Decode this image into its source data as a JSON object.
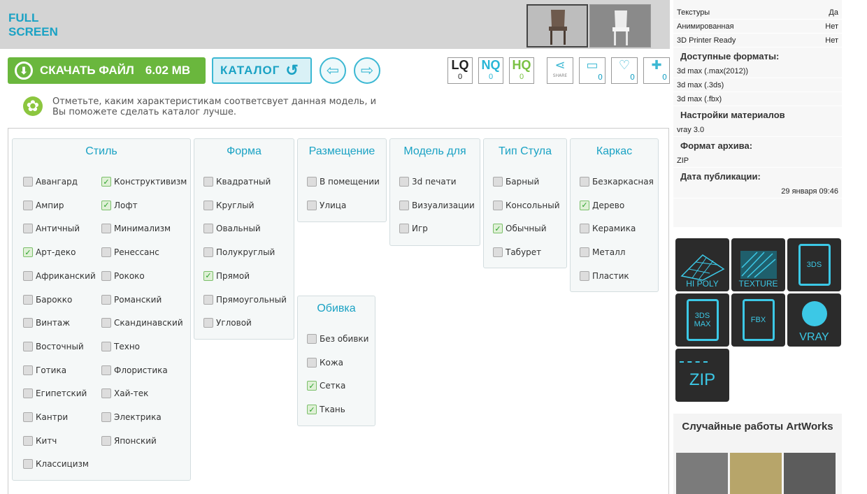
{
  "fullscreen": {
    "line1": "FULL",
    "line2": "SCREEN"
  },
  "download": {
    "label": "СКАЧАТЬ ФАЙЛ",
    "size": "6.02 MB"
  },
  "catalog": {
    "label": "КАТАЛОГ"
  },
  "quality": [
    {
      "label": "LQ",
      "count": "0",
      "color": "#222222"
    },
    {
      "label": "NQ",
      "count": "0",
      "color": "#29b6d6"
    },
    {
      "label": "HQ",
      "count": "0",
      "color": "#7ac143"
    }
  ],
  "social": {
    "share": "SHARE",
    "comments": "0",
    "likes": "0",
    "add": "0"
  },
  "hint": "Отметьте, каким характеристикам соответсвует данная модель, и Вы поможете сделать каталог лучше.",
  "groups": {
    "style": {
      "title": "Стиль",
      "col1": [
        {
          "label": "Авангард",
          "checked": false
        },
        {
          "label": "Ампир",
          "checked": false
        },
        {
          "label": "Античный",
          "checked": false
        },
        {
          "label": "Арт-деко",
          "checked": true
        },
        {
          "label": "Африканский",
          "checked": false
        },
        {
          "label": "Барокко",
          "checked": false
        },
        {
          "label": "Винтаж",
          "checked": false
        },
        {
          "label": "Восточный",
          "checked": false
        },
        {
          "label": "Готика",
          "checked": false
        },
        {
          "label": "Египетский",
          "checked": false
        },
        {
          "label": "Кантри",
          "checked": false
        },
        {
          "label": "Китч",
          "checked": false
        },
        {
          "label": "Классицизм",
          "checked": false
        }
      ],
      "col2": [
        {
          "label": "Конструктивизм",
          "checked": true
        },
        {
          "label": "Лофт",
          "checked": true
        },
        {
          "label": "Минимализм",
          "checked": false
        },
        {
          "label": "Ренессанс",
          "checked": false
        },
        {
          "label": "Рококо",
          "checked": false
        },
        {
          "label": "Романский",
          "checked": false
        },
        {
          "label": "Скандинавский",
          "checked": false
        },
        {
          "label": "Техно",
          "checked": false
        },
        {
          "label": "Флористика",
          "checked": false
        },
        {
          "label": "Хай-тек",
          "checked": false
        },
        {
          "label": "Электрика",
          "checked": false
        },
        {
          "label": "Японский",
          "checked": false
        }
      ]
    },
    "shape": {
      "title": "Форма",
      "items": [
        {
          "label": "Квадратный",
          "checked": false
        },
        {
          "label": "Круглый",
          "checked": false
        },
        {
          "label": "Овальный",
          "checked": false
        },
        {
          "label": "Полукруглый",
          "checked": false
        },
        {
          "label": "Прямой",
          "checked": true
        },
        {
          "label": "Прямоугольный",
          "checked": false
        },
        {
          "label": "Угловой",
          "checked": false
        }
      ]
    },
    "placement": {
      "title": "Размещение",
      "items": [
        {
          "label": "В помещении",
          "checked": false
        },
        {
          "label": "Улица",
          "checked": false
        }
      ]
    },
    "model_for": {
      "title": "Модель для",
      "items": [
        {
          "label": "3d печати",
          "checked": false
        },
        {
          "label": "Визуализации",
          "checked": false
        },
        {
          "label": "Игр",
          "checked": false
        }
      ]
    },
    "chair_type": {
      "title": "Тип Стула",
      "items": [
        {
          "label": "Барный",
          "checked": false
        },
        {
          "label": "Консольный",
          "checked": false
        },
        {
          "label": "Обычный",
          "checked": true
        },
        {
          "label": "Табурет",
          "checked": false
        }
      ]
    },
    "frame": {
      "title": "Каркас",
      "items": [
        {
          "label": "Безкаркасная",
          "checked": false
        },
        {
          "label": "Дерево",
          "checked": true
        },
        {
          "label": "Керамика",
          "checked": false
        },
        {
          "label": "Металл",
          "checked": false
        },
        {
          "label": "Пластик",
          "checked": false
        }
      ]
    },
    "upholstery": {
      "title": "Обивка",
      "items": [
        {
          "label": "Без обивки",
          "checked": false
        },
        {
          "label": "Кожа",
          "checked": false
        },
        {
          "label": "Сетка",
          "checked": true
        },
        {
          "label": "Ткань",
          "checked": true
        }
      ]
    }
  },
  "sidebar": {
    "props": [
      {
        "k": "Текстуры",
        "v": "Да"
      },
      {
        "k": "Анимированная",
        "v": "Нет"
      },
      {
        "k": "3D Printer Ready",
        "v": "Нет"
      }
    ],
    "formats_title": "Доступные форматы:",
    "formats": [
      "3d max (.max(2012))",
      "3d max (.3ds)",
      "3d max (.fbx)"
    ],
    "materials_title": "Настройки материалов",
    "materials": "vray 3.0",
    "archive_title": "Формат архива:",
    "archive": "ZIP",
    "date_title": "Дата публикации:",
    "date": "29 января 09:46"
  },
  "tiles": [
    {
      "label": "HI POLY"
    },
    {
      "label": "TEXTURE"
    },
    {
      "label": "3DS"
    },
    {
      "label": "3DS MAX"
    },
    {
      "label": "FBX"
    },
    {
      "label": "VRAY"
    },
    {
      "label": "ZIP"
    }
  ],
  "artworks_title": "Случайные работы ArtWorks"
}
